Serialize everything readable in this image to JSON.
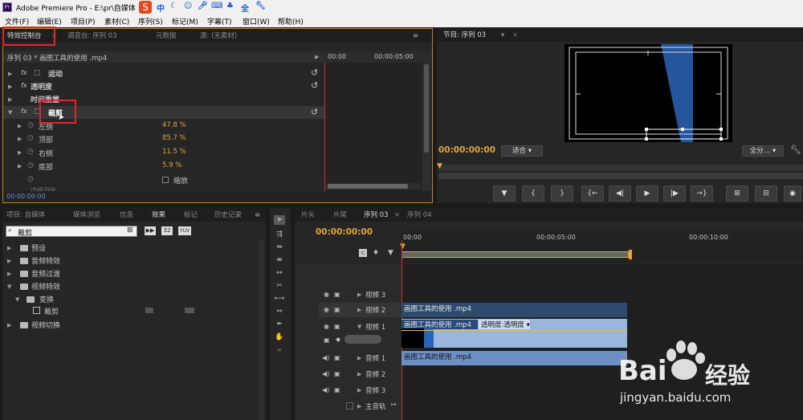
{
  "window": {
    "title": "Adobe Premiere Pro - E:\\pr\\自媒体",
    "app_icon": "Pr"
  },
  "ime": {
    "logo": "S",
    "label": "中",
    "icons": [
      "moon-icon",
      "smile-icon",
      "mic-icon",
      "keyboard-icon",
      "shirt-icon",
      "all-icon",
      "wrench-icon"
    ]
  },
  "menu": [
    "文件(F)",
    "编辑(E)",
    "项目(P)",
    "素材(C)",
    "序列(S)",
    "标记(M)",
    "字幕(T)",
    "窗口(W)",
    "帮助(H)"
  ],
  "effect_controls": {
    "tabs": [
      "特效控制台",
      "调音台: 序列 03",
      "元数据",
      "源: (无素材)"
    ],
    "sequence_title": "序列 03 * 画图工具的使用 .mp4",
    "ruler_start": "00:00",
    "ruler_mid": "00:00:05:00",
    "effects": [
      {
        "fx": "fx",
        "name": "运动"
      },
      {
        "fx": "fx",
        "name": "透明度"
      },
      {
        "fx": "",
        "name": "时间重置"
      },
      {
        "fx": "fx",
        "name": "裁剪"
      }
    ],
    "params": [
      {
        "name": "左侧",
        "value": "47.8 %"
      },
      {
        "name": "顶部",
        "value": "85.7 %"
      },
      {
        "name": "右侧",
        "value": "11.5 %"
      },
      {
        "name": "底部",
        "value": "5.9 %"
      }
    ],
    "zoom_label": "缩放",
    "partial_row": "边缘羽化",
    "timecode": "00:00:00:00"
  },
  "program": {
    "tab": "节目: 序列 03",
    "timecode": "00:00:00:00",
    "fit": "适合",
    "quality": "全分…",
    "transport": [
      "▼",
      "{",
      "}",
      "{←",
      "◀|",
      "▶",
      "|▶",
      "→}",
      "⊞",
      "⊟",
      "◉"
    ]
  },
  "project": {
    "tabs": [
      "项目: 自媒体",
      "媒体浏览",
      "信息",
      "效果",
      "标记",
      "历史记录"
    ],
    "search_value": "裁剪",
    "badges": [
      "32",
      "YUV"
    ],
    "tree": [
      {
        "label": "预设",
        "level": 0,
        "expanded": false
      },
      {
        "label": "音频特效",
        "level": 0,
        "expanded": false
      },
      {
        "label": "音频过渡",
        "level": 0,
        "expanded": false
      },
      {
        "label": "视频特效",
        "level": 0,
        "expanded": true
      },
      {
        "label": "变换",
        "level": 1,
        "expanded": true
      },
      {
        "label": "裁剪",
        "level": 2,
        "expanded": false
      },
      {
        "label": "视频切换",
        "level": 0,
        "expanded": false
      }
    ]
  },
  "timeline": {
    "tabs": [
      "片头",
      "片尾",
      "序列 03",
      "序列 04"
    ],
    "timecode": "00:00:00:00",
    "ruler": [
      "00:00",
      "00:00:05:00",
      "00:00:10:00"
    ],
    "tracks": [
      {
        "name": "视频 3"
      },
      {
        "name": "视频 2",
        "clip": "画图工具的使用 .mp4"
      },
      {
        "name": "视频 1",
        "clip": "画图工具的使用 .mp4",
        "opacity": "透明度:透明度"
      },
      {
        "name": "音频 1",
        "clip": "画图工具的使用 .mp4"
      },
      {
        "name": "音频 2"
      },
      {
        "name": "音频 3"
      },
      {
        "name": "主音轨"
      }
    ]
  },
  "watermark": {
    "brand": "Bai",
    "brand2": "经验",
    "url": "jingyan.baidu.com"
  },
  "colors": {
    "accent": "#e0a53a",
    "highlight_box": "#e0262d",
    "clip_blue": "#7b9fcf",
    "audio_clip": "#6d8fc4"
  }
}
